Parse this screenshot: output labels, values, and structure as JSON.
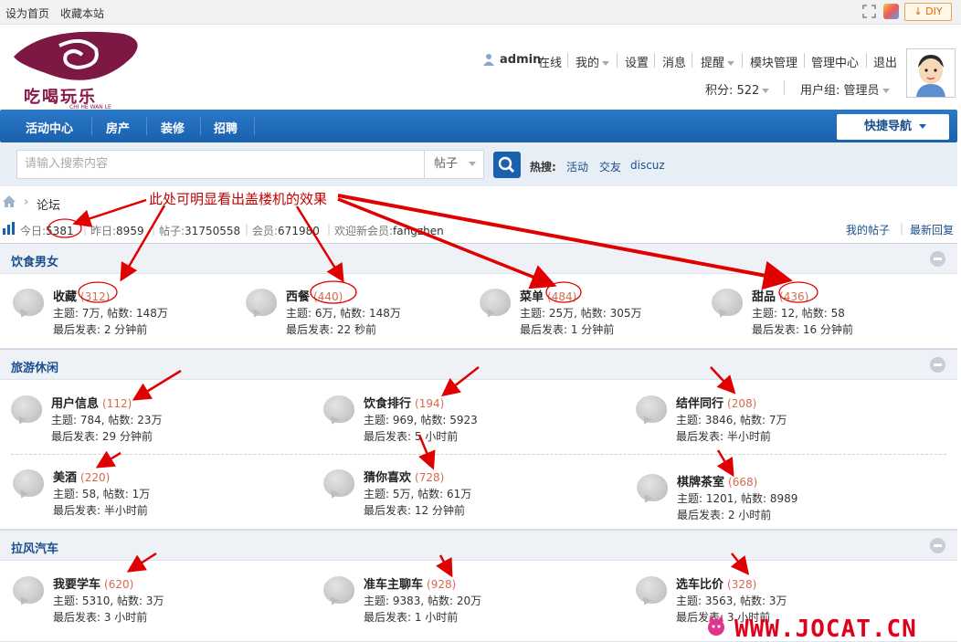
{
  "topbar": {
    "set_home": "设为首页",
    "bookmark": "收藏本站",
    "diy": "DIY"
  },
  "header": {
    "brand": "吃喝玩乐",
    "brand_sub": "CHI HE WAN LE",
    "user": "admin",
    "online": "在线",
    "menu": [
      "我的",
      "设置",
      "消息",
      "提醒",
      "模块管理",
      "管理中心",
      "退出"
    ],
    "points": "积分: 522",
    "usergroup": "用户组: 管理员"
  },
  "nav": {
    "items": [
      "活动中心",
      "房产",
      "装修",
      "招聘"
    ],
    "quick": "快捷导航"
  },
  "search": {
    "placeholder": "请输入搜索内容",
    "type": "帖子",
    "hot_label": "热搜:",
    "hot": [
      "活动",
      "交友",
      "discuz"
    ]
  },
  "breadcrumb": {
    "forum": "论坛"
  },
  "stats": {
    "today_label": "今日:",
    "today": "5381",
    "yesterday_label": "昨日:",
    "yesterday": "8959",
    "posts_label": "帖子:",
    "posts": "31750558",
    "members_label": "会员:",
    "members": "671980",
    "welcome_label": "欢迎新会员:",
    "welcome": "fangzhen",
    "my_posts": "我的帖子",
    "latest": "最新回复"
  },
  "annotation": "此处可明显看出盖楼机的效果",
  "categories": [
    {
      "title": "饮食男女",
      "forums": [
        {
          "name": "收藏",
          "count": "(312)",
          "line1": "主题: 7万, 帖数: 148万",
          "line2": "最后发表: 2 分钟前"
        },
        {
          "name": "西餐",
          "count": "(440)",
          "line1": "主题: 6万, 帖数: 148万",
          "line2": "最后发表: 22 秒前"
        },
        {
          "name": "菜单",
          "count": "(484)",
          "line1": "主题: 25万, 帖数: 305万",
          "line2": "最后发表: 1 分钟前"
        },
        {
          "name": "甜品",
          "count": "(436)",
          "line1": "主题: 12, 帖数: 58",
          "line2": "最后发表: 16 分钟前"
        }
      ]
    },
    {
      "title": "旅游休闲",
      "forums": [
        {
          "name": "用户信息",
          "count": "(112)",
          "line1": "主题: 784, 帖数: 23万",
          "line2": "最后发表: 29 分钟前"
        },
        {
          "name": "饮食排行",
          "count": "(194)",
          "line1": "主题: 969, 帖数: 5923",
          "line2": "最后发表: 5 小时前"
        },
        {
          "name": "结伴同行",
          "count": "(208)",
          "line1": "主题: 3846, 帖数: 7万",
          "line2": "最后发表: 半小时前"
        },
        {
          "name": "美酒",
          "count": "(220)",
          "line1": "主题: 58, 帖数: 1万",
          "line2": "最后发表: 半小时前"
        },
        {
          "name": "猜你喜欢",
          "count": "(728)",
          "line1": "主题: 5万, 帖数: 61万",
          "line2": "最后发表: 12 分钟前"
        },
        {
          "name": "棋牌茶室",
          "count": "(668)",
          "line1": "主题: 1201, 帖数: 8989",
          "line2": "最后发表: 2 小时前"
        }
      ]
    },
    {
      "title": "拉风汽车",
      "forums": [
        {
          "name": "我要学车",
          "count": "(620)",
          "line1": "主题: 5310, 帖数: 3万",
          "line2": "最后发表: 3 小时前"
        },
        {
          "name": "准车主聊车",
          "count": "(928)",
          "line1": "主题: 9383, 帖数: 20万",
          "line2": "最后发表: 1 小时前"
        },
        {
          "name": "选车比价",
          "count": "(328)",
          "line1": "主题: 3563, 帖数: 3万",
          "line2": "最后发表: 3 小时前"
        }
      ]
    }
  ],
  "watermark": "WWW.JOCAT.CN",
  "colors": {
    "nav": "#1a61ad",
    "count": "#d46b4e",
    "annotation": "#c00000",
    "brand": "#8b1a4a"
  }
}
